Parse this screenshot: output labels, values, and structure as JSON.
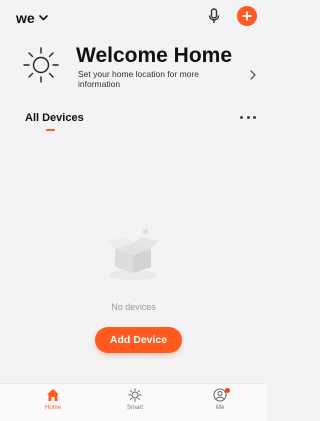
{
  "colors": {
    "accent": "#ff5a1f",
    "background": "#f3f3f3",
    "muted_text": "#999999"
  },
  "header": {
    "home_name": "we",
    "home_dropdown_icon": "chevron-down-icon",
    "mic_icon": "microphone-icon",
    "add_icon": "plus-icon"
  },
  "welcome": {
    "icon": "sun-icon",
    "title": "Welcome Home",
    "subtitle": "Set your home location for more information",
    "chevron_icon": "chevron-right-icon"
  },
  "devices": {
    "title": "All Devices",
    "more_icon": "more-horizontal-icon",
    "empty_icon": "empty-box-icon",
    "empty_text": "No devices",
    "add_button_label": "Add Device"
  },
  "bottom_nav": {
    "items": [
      {
        "label": "Home",
        "icon": "home-icon",
        "active": true
      },
      {
        "label": "Smart",
        "icon": "smart-sun-icon",
        "active": false
      },
      {
        "label": "Me",
        "icon": "profile-icon",
        "active": false,
        "badge": true
      }
    ]
  }
}
